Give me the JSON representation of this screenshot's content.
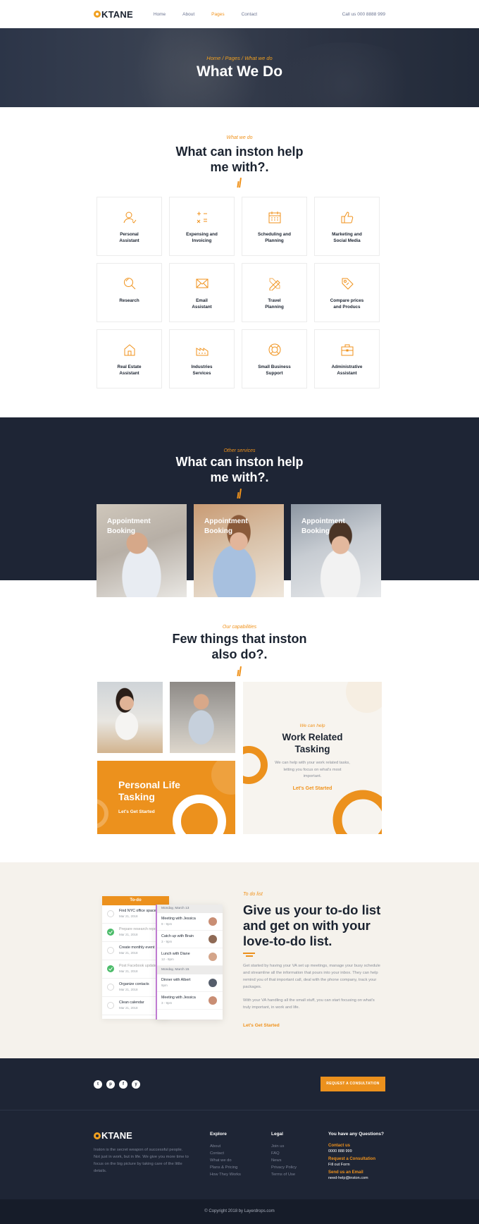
{
  "header": {
    "logo": "OKTANE",
    "nav": [
      {
        "label": "Home",
        "active": false
      },
      {
        "label": "About",
        "active": false
      },
      {
        "label": "Pages",
        "active": true
      },
      {
        "label": "Contact",
        "active": false
      }
    ],
    "call": "Call us 000 8888 999"
  },
  "hero": {
    "breadcrumb": "Home / Pages / What we do",
    "title": "What We Do"
  },
  "services": {
    "kicker": "What we do",
    "title": "What can inston help\nme with?.",
    "items": [
      {
        "label": "Personal\nAssistant",
        "icon": "person-icon"
      },
      {
        "label": "Expensing and\nInvoicing",
        "icon": "calculator-icon"
      },
      {
        "label": "Scheduling and\nPlanning",
        "icon": "calendar-icon"
      },
      {
        "label": "Marketing and\nSocial Media",
        "icon": "thumbs-up-icon"
      },
      {
        "label": "Research",
        "icon": "magnifier-icon"
      },
      {
        "label": "Email\nAssistant",
        "icon": "envelope-icon"
      },
      {
        "label": "Travel\nPlanning",
        "icon": "pencil-ruler-icon"
      },
      {
        "label": "Compare prices\nand Producs",
        "icon": "price-tag-icon"
      },
      {
        "label": "Real Estate\nAssistant",
        "icon": "house-icon"
      },
      {
        "label": "Industries\nServices",
        "icon": "factory-icon"
      },
      {
        "label": "Small Business\nSupport",
        "icon": "lifebuoy-icon"
      },
      {
        "label": "Administrative\nAssistant",
        "icon": "briefcase-icon"
      }
    ]
  },
  "other": {
    "kicker": "Other services",
    "title": "What can inston help\nme with?.",
    "cards": [
      {
        "label": "Appointment\nBooking"
      },
      {
        "label": "Appointment\nBooking"
      },
      {
        "label": "Appointment\nBooking"
      }
    ]
  },
  "capabilities": {
    "kicker": "Our capabilities",
    "title": "Few things that inston\nalso do?.",
    "personal": {
      "title": "Personal Life\nTasking",
      "cta": "Let's Get Started"
    },
    "work": {
      "kicker": "We can help",
      "title": "Work Related\nTasking",
      "desc": "We can help with your work related tasks, letting you focus on what's most important.",
      "cta": "Let's Get Started"
    }
  },
  "todo": {
    "list_title": "To-do",
    "tasks": [
      {
        "name": "Find NYC office space",
        "date": "Mar 21, 2018",
        "done": false
      },
      {
        "name": "Prepare research report",
        "date": "Mar 21, 2018",
        "done": true
      },
      {
        "name": "Create monthly event",
        "date": "Mar 21, 2018",
        "done": false
      },
      {
        "name": "Post Facebook update",
        "date": "Mar 21, 2018",
        "done": true
      },
      {
        "name": "Organize contacts",
        "date": "Mar 21, 2018",
        "done": false
      },
      {
        "name": "Clean calendar",
        "date": "Mar 21, 2018",
        "done": false
      }
    ],
    "day1": "Monday, March 13",
    "events1": [
      {
        "name": "Meeting with Jessica",
        "time": "9 - 9pm"
      },
      {
        "name": "Catch up with Brain",
        "time": "3 - 9pm"
      },
      {
        "name": "Lunch with Diane",
        "time": "12 - 9pm"
      }
    ],
    "day2": "Monday, March 15",
    "events2": [
      {
        "name": "Dinner with Albert",
        "time": "9pm"
      },
      {
        "name": "Meeting with Jessica",
        "time": "3 - 9pm"
      }
    ],
    "kicker": "To do list",
    "title": "Give us your to-do list\nand get on with your\nlove-to-do list.",
    "p1": "Get started by having your VA set up meetings, manage your busy schedule and streamline all the information that pours into your inbox. They can help remind you of that important call, deal with the phone company, track your packages.",
    "p2": "With your VA handling all the small stuff, you can start focusing on what's truly important, in work and life.",
    "cta": "Let's Get Started"
  },
  "footer": {
    "socials": [
      "t",
      "p",
      "f",
      "y"
    ],
    "request_btn": "REQUEST A CONSULTATION",
    "logo": "OKTANE",
    "desc": "Inston is the secret weapon of successful people. Not just in work, but in life. We give you more time to focus on the big picture by taking care of the little details.",
    "explore_title": "Explore",
    "explore": [
      "About",
      "Contact",
      "What we do",
      "Plans & Pricing",
      "How They Works"
    ],
    "legal_title": "Legal",
    "legal": [
      "Join us",
      "FAQ",
      "News",
      "Privacy Policy",
      "Terms of Use"
    ],
    "questions_title": "You have any Questions?",
    "contact_k": "Contact us",
    "contact_v": "0000 888 999",
    "consult_k": "Request a Consultation",
    "consult_v": "Fill out Form",
    "email_k": "Send us an Email",
    "email_v": "need-help@inston.com",
    "copyright": "© Copyright 2018 by Layerdrops.com"
  }
}
